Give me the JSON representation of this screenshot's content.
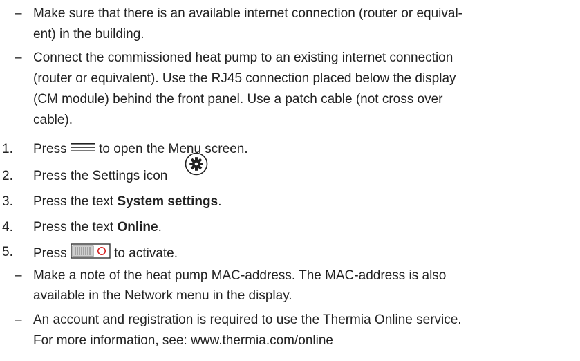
{
  "prereq_items": [
    {
      "dash": "–",
      "lines": [
        "Make sure that there is an available internet connection (router or equival-",
        "ent) in the building."
      ]
    },
    {
      "dash": "–",
      "lines": [
        "Connect the commissioned heat pump to an existing internet connection",
        "(router or equivalent). Use the RJ45 connection placed below the display",
        "(CM module) behind the front panel. Use a patch cable (not cross over",
        "cable)."
      ]
    }
  ],
  "steps": [
    {
      "number": "1.",
      "before": "Press ",
      "icon": "menu-icon",
      "after": " to open the Menu screen."
    },
    {
      "number": "2.",
      "before": "Press the Settings icon ",
      "icon": "settings-gear-icon",
      "after": ""
    },
    {
      "number": "3.",
      "before": "Press the text ",
      "bold": "System settings",
      "after": "."
    },
    {
      "number": "4.",
      "before": "Press the text ",
      "bold": "Online",
      "after": "."
    },
    {
      "number": "5.",
      "before": "Press ",
      "icon": "toggle-switch-icon",
      "after": " to activate."
    }
  ],
  "notes": [
    {
      "dash": "–",
      "lines": [
        "Make a note of the heat pump MAC-address. The MAC-address is also",
        "available in the Network menu in the display."
      ]
    },
    {
      "dash": "–",
      "lines": [
        "An account and registration is required to use the Thermia Online service.",
        "For more information, see: www.thermia.com/online"
      ]
    }
  ]
}
